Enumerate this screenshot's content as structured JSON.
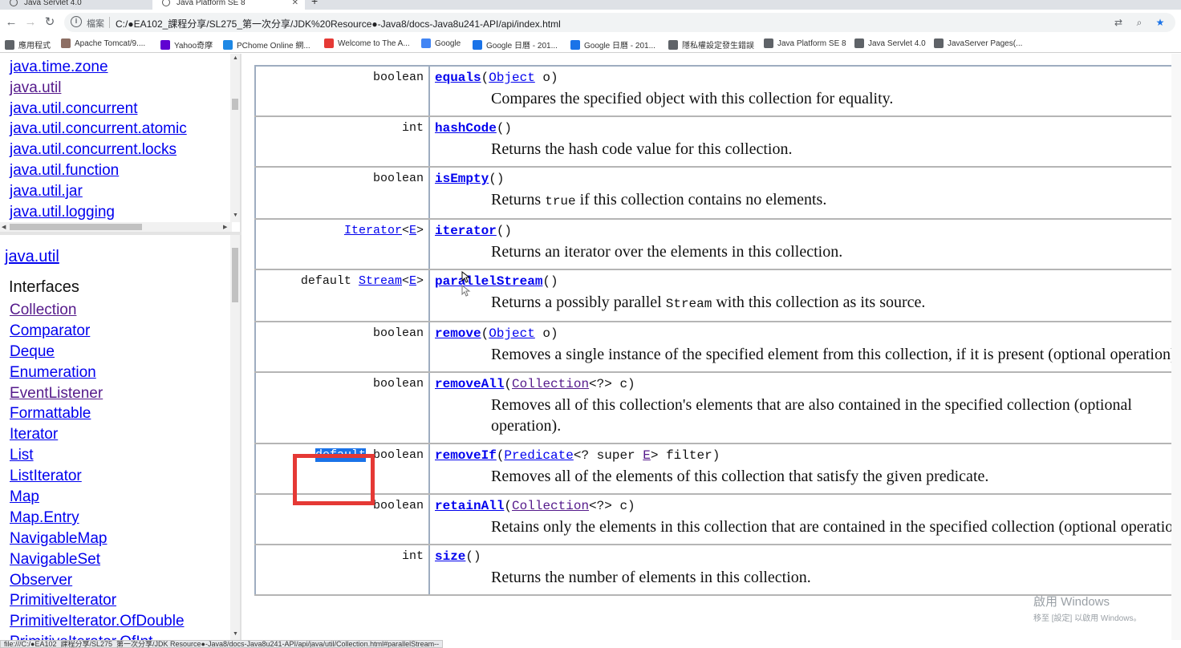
{
  "tabs": [
    {
      "label": "Java Servlet 4.0"
    },
    {
      "label": "Java Platform SE 8"
    }
  ],
  "address": {
    "security_label": "檔案",
    "url": "C:/●EA102_課程分享/SL275_第一次分享/JDK%20Resource●-Java8/docs-Java8u241-API/api/index.html"
  },
  "bookmarks": [
    {
      "label": "應用程式",
      "color": "#5f6368"
    },
    {
      "label": "Apache Tomcat/9....",
      "color": "#8d6e63"
    },
    {
      "label": "Yahoo奇摩",
      "color": "#6001d2"
    },
    {
      "label": "PChome Online 網...",
      "color": "#1e88e5"
    },
    {
      "label": "Welcome to The A...",
      "color": "#e53935"
    },
    {
      "label": "Google",
      "color": "#4285f4"
    },
    {
      "label": "Google 日曆 - 201...",
      "color": "#1a73e8"
    },
    {
      "label": "Google 日曆 - 201...",
      "color": "#1a73e8"
    },
    {
      "label": "隱私權設定發生錯誤",
      "color": "#5f6368"
    },
    {
      "label": "Java Platform SE 8",
      "color": "#5f6368"
    },
    {
      "label": "Java Servlet 4.0",
      "color": "#5f6368"
    },
    {
      "label": "JavaServer Pages(...",
      "color": "#5f6368"
    }
  ],
  "packages": [
    {
      "label": "java.time.zone",
      "visited": false
    },
    {
      "label": "java.util",
      "visited": true
    },
    {
      "label": "java.util.concurrent",
      "visited": false
    },
    {
      "label": "java.util.concurrent.atomic",
      "visited": false
    },
    {
      "label": "java.util.concurrent.locks",
      "visited": false
    },
    {
      "label": "java.util.function",
      "visited": false
    },
    {
      "label": "java.util.jar",
      "visited": false
    },
    {
      "label": "java.util.logging",
      "visited": false
    }
  ],
  "package_frame": {
    "title": "java.util",
    "heading": "Interfaces",
    "items": [
      {
        "label": "Collection",
        "visited": true
      },
      {
        "label": "Comparator",
        "visited": false
      },
      {
        "label": "Deque",
        "visited": false
      },
      {
        "label": "Enumeration",
        "visited": false
      },
      {
        "label": "EventListener",
        "visited": true
      },
      {
        "label": "Formattable",
        "visited": false
      },
      {
        "label": "Iterator",
        "visited": false
      },
      {
        "label": "List",
        "visited": false
      },
      {
        "label": "ListIterator",
        "visited": false
      },
      {
        "label": "Map",
        "visited": false
      },
      {
        "label": "Map.Entry",
        "visited": false
      },
      {
        "label": "NavigableMap",
        "visited": false
      },
      {
        "label": "NavigableSet",
        "visited": false
      },
      {
        "label": "Observer",
        "visited": false
      },
      {
        "label": "PrimitiveIterator",
        "visited": false
      },
      {
        "label": "PrimitiveIterator.OfDouble",
        "visited": false
      },
      {
        "label": "PrimitiveIterator.OfInt",
        "visited": false
      }
    ]
  },
  "methods": [
    {
      "modifier": [
        {
          "text": "boolean"
        }
      ],
      "name": "equals",
      "params": [
        {
          "text": "("
        },
        {
          "text": "Object",
          "link": true
        },
        {
          "text": " o)"
        }
      ],
      "desc": [
        {
          "text": "Compares the specified object with this collection for equality."
        }
      ]
    },
    {
      "modifier": [
        {
          "text": "int"
        }
      ],
      "name": "hashCode",
      "params": [
        {
          "text": "()"
        }
      ],
      "desc": [
        {
          "text": "Returns the hash code value for this collection."
        }
      ]
    },
    {
      "modifier": [
        {
          "text": "boolean"
        }
      ],
      "name": "isEmpty",
      "params": [
        {
          "text": "()"
        }
      ],
      "desc": [
        {
          "text": "Returns "
        },
        {
          "text": "true",
          "code": true
        },
        {
          "text": " if this collection contains no elements."
        }
      ]
    },
    {
      "modifier": [
        {
          "text": "Iterator",
          "link": true
        },
        {
          "text": "<"
        },
        {
          "text": "E",
          "link": true
        },
        {
          "text": ">"
        }
      ],
      "name": "iterator",
      "params": [
        {
          "text": "()"
        }
      ],
      "desc": [
        {
          "text": "Returns an iterator over the elements in this collection."
        }
      ]
    },
    {
      "modifier": [
        {
          "text": "default "
        },
        {
          "text": "Stream",
          "link": true
        },
        {
          "text": "<"
        },
        {
          "text": "E",
          "link": true
        },
        {
          "text": ">"
        }
      ],
      "name": "parallelStream",
      "params": [
        {
          "text": "()"
        }
      ],
      "desc": [
        {
          "text": "Returns a possibly parallel "
        },
        {
          "text": "Stream",
          "code": true
        },
        {
          "text": " with this collection as its source."
        }
      ]
    },
    {
      "modifier": [
        {
          "text": "boolean"
        }
      ],
      "name": "remove",
      "params": [
        {
          "text": "("
        },
        {
          "text": "Object",
          "link": true
        },
        {
          "text": " o)"
        }
      ],
      "desc": [
        {
          "text": "Removes a single instance of the specified element from this collection, if it is present (optional operation)."
        }
      ]
    },
    {
      "modifier": [
        {
          "text": "boolean"
        }
      ],
      "name": "removeAll",
      "params": [
        {
          "text": "("
        },
        {
          "text": "Collection",
          "link": true,
          "visited": true
        },
        {
          "text": "<?> c)"
        }
      ],
      "desc": [
        {
          "text": "Removes all of this collection's elements that are also contained in the specified collection (optional operation)."
        }
      ]
    },
    {
      "modifier": [
        {
          "text": "default",
          "highlight": true
        },
        {
          "text": " boolean"
        }
      ],
      "name": "removeIf",
      "params": [
        {
          "text": "("
        },
        {
          "text": "Predicate",
          "link": true
        },
        {
          "text": "<? super "
        },
        {
          "text": "E",
          "link": true,
          "visited": true
        },
        {
          "text": "> filter)"
        }
      ],
      "desc": [
        {
          "text": "Removes all of the elements of this collection that satisfy the given predicate."
        }
      ]
    },
    {
      "modifier": [
        {
          "text": "boolean"
        }
      ],
      "name": "retainAll",
      "params": [
        {
          "text": "("
        },
        {
          "text": "Collection",
          "link": true,
          "visited": true
        },
        {
          "text": "<?> c)"
        }
      ],
      "desc": [
        {
          "text": "Retains only the elements in this collection that are contained in the specified collection (optional operation)."
        }
      ]
    },
    {
      "modifier": [
        {
          "text": "int"
        }
      ],
      "name": "size",
      "params": [
        {
          "text": "()"
        }
      ],
      "desc": [
        {
          "text": "Returns the number of elements in this collection."
        }
      ]
    }
  ],
  "watermark": {
    "line1": "啟用 Windows",
    "line2": "移至 [設定] 以啟用 Windows。"
  },
  "status_bar": "file:///C:/●EA102_課程分享/SL275_第一次分享/JDK Resource●-Java8/docs-Java8u241-API/api/java/util/Collection.html#parallelStream--",
  "colors": {
    "link": "#0000ee",
    "visited": "#551a8b",
    "highlight": "#1a73e8",
    "annotation": "#e53935"
  }
}
